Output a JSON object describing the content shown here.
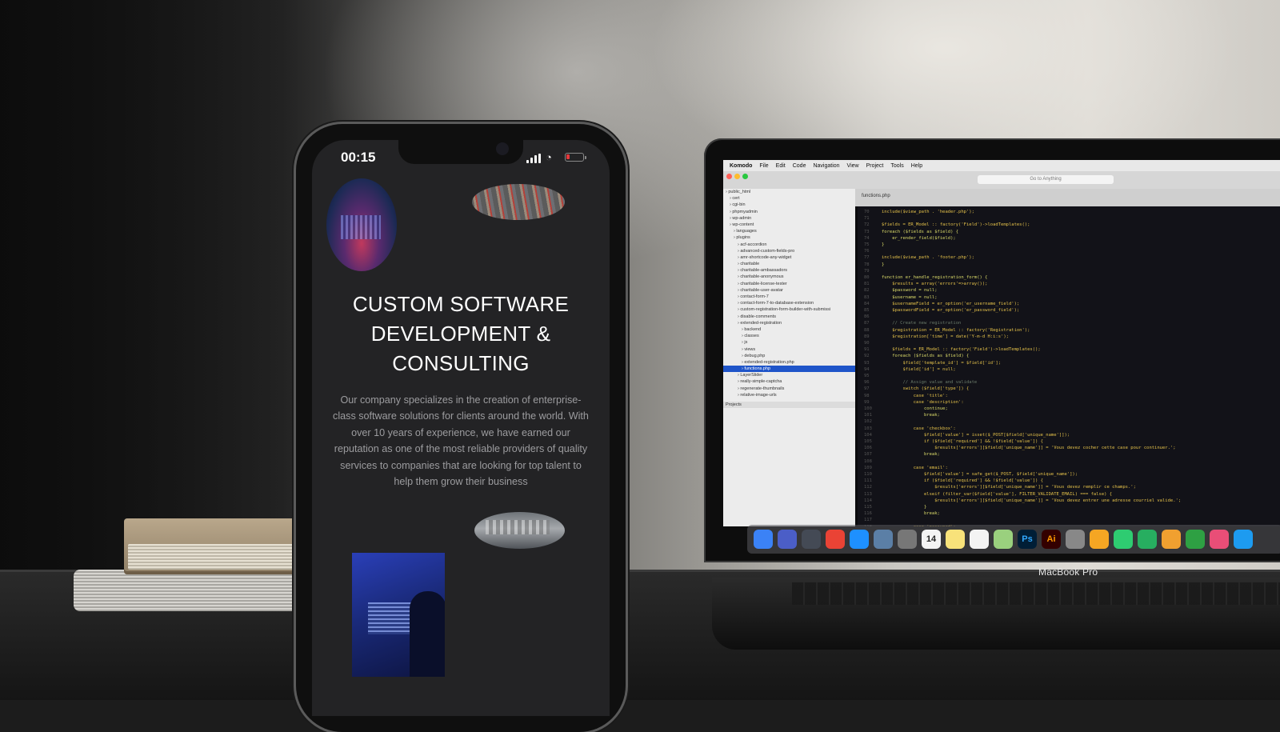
{
  "phone": {
    "status_time": "00:15",
    "icons": [
      "signal-icon",
      "wifi-icon",
      "battery-icon"
    ],
    "hero_title": "CUSTOM SOFTWARE DEVELOPMENT & CONSULTING",
    "hero_text": "Our company specializes in the creation of enterprise-class software solutions for clients around the world. With over 10 years of experience, we have earned our reputation as one of the most reliable providers of quality services to companies that are looking for top talent to help them grow their business",
    "battery_level": 0.2,
    "colors": {
      "screen_bg": "#232325",
      "title": "#ffffff",
      "body_text": "#9c9c9f",
      "battery_low": "#e5383b"
    }
  },
  "laptop": {
    "brand": "MacBook Pro",
    "menubar": [
      "Komodo",
      "File",
      "Edit",
      "Code",
      "Navigation",
      "View",
      "Project",
      "Tools",
      "Help"
    ],
    "search_placeholder": "Go to Anything",
    "tab_label": "functions.php",
    "sidebar_items": [
      "public_html",
      "cert",
      "cgi-bin",
      "phpmyadmin",
      "wp-admin",
      "wp-content",
      "languages",
      "plugins",
      "acf-accordion",
      "advanced-custom-fields-pro",
      "amr-shortcode-any-widget",
      "charitable",
      "charitable-ambassadors",
      "charitable-anonymous",
      "charitable-license-tester",
      "charitable-user-avatar",
      "contact-form-7",
      "contact-form-7-to-database-extension",
      "custom-registration-form-builder-with-submissi",
      "disable-comments",
      "extended-registration",
      "backend",
      "classes",
      "js",
      "views",
      "debug.php",
      "extended-registration.php",
      "functions.php",
      "LayerSlider",
      "really-simple-captcha",
      "regenerate-thumbnails",
      "relative-image-urls"
    ],
    "selected_item": "functions.php",
    "projects_label": "Projects",
    "code_lines": [
      "include($view_path . 'header.php');",
      "",
      "$fields = ER_Model :: factory('Field')->loadTemplates();",
      "foreach ($fields as $field) {",
      "    er_render_field($field);",
      "}",
      "",
      "include($view_path . 'footer.php');",
      "}",
      "",
      "function er_handle_registration_form() {",
      "    $results = array('errors'=>array());",
      "    $password = null;",
      "    $username = null;",
      "    $usernameField = er_option('er_username_field');",
      "    $passwordField = er_option('er_password_field');",
      "",
      "    // Create new registration",
      "    $registration = ER_Model :: factory('Registration');",
      "    $registration['time'] = date('Y-m-d H:i:s');",
      "",
      "    $fields = ER_Model :: factory('Field')->loadTemplates();",
      "    foreach ($fields as $field) {",
      "        $field['template_id'] = $field['id'];",
      "        $field['id'] = null;",
      "",
      "        // Assign value and validate",
      "        switch ($field['type']) {",
      "            case 'title':",
      "            case 'description':",
      "                continue;",
      "                break;",
      "",
      "            case 'checkbox':",
      "                $field['value'] = isset($_POST[$field['unique_name']]);",
      "                if ($field['required'] && !$field['value']) {",
      "                    $results['errors'][$field['unique_name']] = 'Vous devez cocher cette case pour continuer.';",
      "                break;",
      "",
      "            case 'email':",
      "                $field['value'] = safe_get($_POST, $field['unique_name']);",
      "                if ($field['required'] && !$field['value']) {",
      "                    $results['errors'][$field['unique_name']] = 'Vous devez remplir ce champs.';",
      "                elseif (filter_var($field['value'], FILTER_VALIDATE_EMAIL) === false) {",
      "                    $results['errors'][$field['unique_name']] = 'Vous devez entrer une adresse courriel valide.';",
      "                }",
      "                break;",
      "",
      "            case 'password':"
    ],
    "dock_icons": [
      "finder-icon",
      "siri-icon",
      "launchpad-icon",
      "chrome-icon",
      "safari-icon",
      "preview-icon",
      "system-preferences-icon",
      "calendar-icon",
      "notes-icon",
      "reminders-icon",
      "maps-icon",
      "photoshop-icon",
      "illustrator-icon",
      "settings-icon",
      "photos-icon",
      "messages-icon",
      "facetime-icon",
      "pages-icon",
      "numbers-icon",
      "itunes-icon",
      "app-store-icon"
    ],
    "dock_labels": {
      "photoshop": "Ps",
      "illustrator": "Ai",
      "calendar": "14"
    }
  }
}
